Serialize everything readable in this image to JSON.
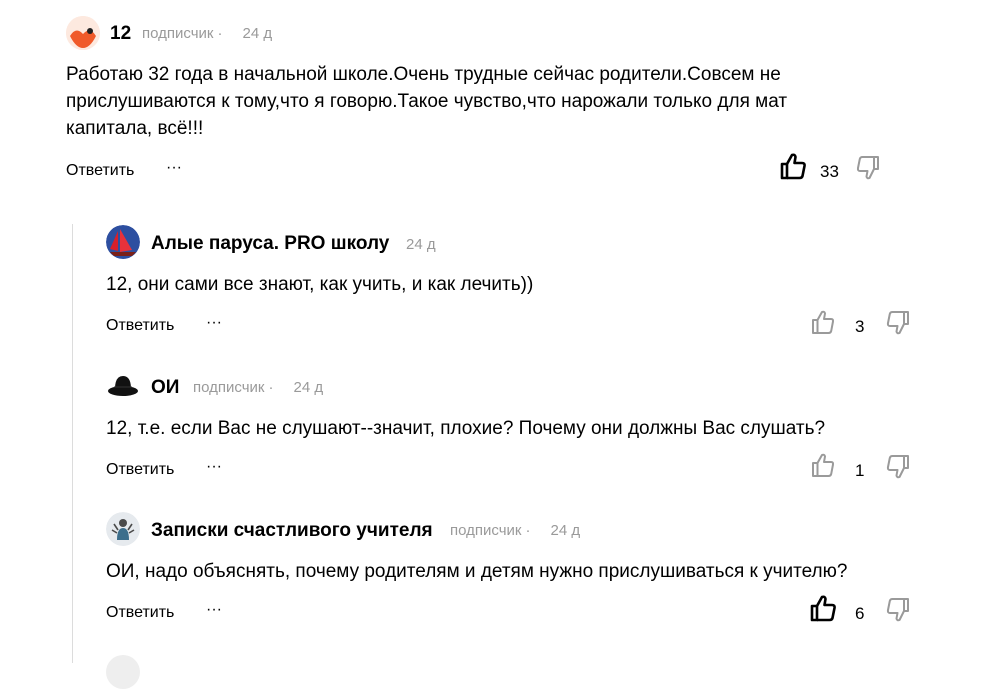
{
  "comments": [
    {
      "author": "12",
      "subscriber": "подписчик",
      "time": "24 д",
      "text": "Работаю 32 года в начальной школе.Очень трудные сейчас родители.Совсем не прислушиваются к тому,что я говорю.Такое чувство,что нарожали только для мат капитала, всё!!!",
      "reply_label": "Ответить",
      "more_label": "···",
      "likes": "33",
      "liked": true
    },
    {
      "author": "Алые паруса. PRO школу",
      "time": "24 д",
      "text": "12, они сами все знают, как учить, и как лечить))",
      "reply_label": "Ответить",
      "more_label": "···",
      "likes": "3",
      "liked": false
    },
    {
      "author": "ОИ",
      "subscriber": "подписчик",
      "time": "24 д",
      "text": "12, т.е. если Вас не слушают--значит, плохие? Почему они должны Вас слушать?",
      "reply_label": "Ответить",
      "more_label": "···",
      "likes": "1",
      "liked": false
    },
    {
      "author": "Записки счастливого учителя",
      "subscriber": "подписчик",
      "time": "24 д",
      "text": "ОИ, надо объяснять, почему родителям и детям нужно прислушиваться к учителю?",
      "reply_label": "Ответить",
      "more_label": "···",
      "likes": "6",
      "liked": true
    }
  ],
  "icons": {
    "like": "thumbs-up-icon",
    "dislike": "thumbs-down-icon",
    "more": "more-dots-icon"
  },
  "colors": {
    "meta_gray": "#9a9a9a",
    "thread_line": "#dcdcdc",
    "avatar_orange": "#f05a2a"
  }
}
